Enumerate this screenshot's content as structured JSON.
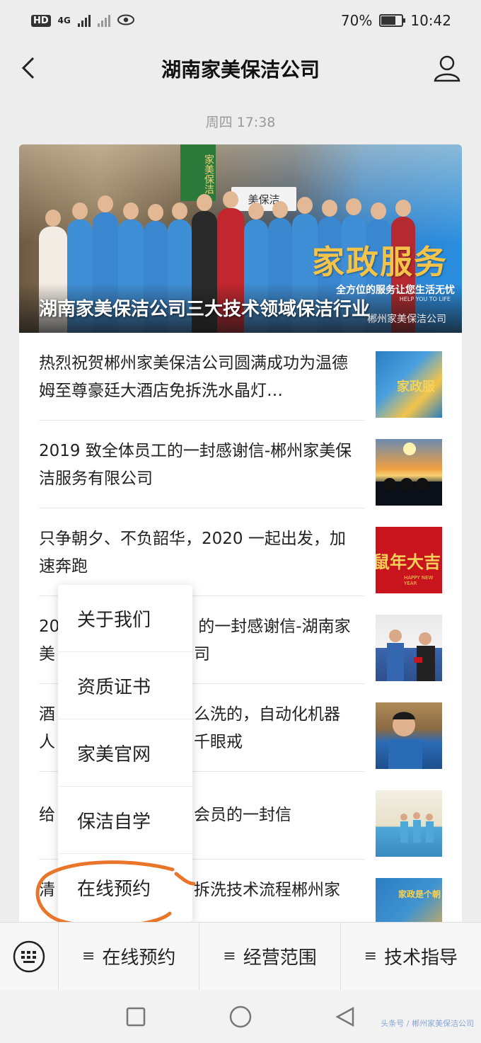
{
  "status_bar": {
    "left_badge": "HD",
    "network": "4G",
    "battery_percent": "70%",
    "battery_level": 0.7,
    "time": "10:42"
  },
  "nav": {
    "title": "湖南家美保洁公司",
    "back_icon": "chevron-left-icon",
    "profile_icon": "person-icon"
  },
  "timestamp": "周四 17:38",
  "hero": {
    "title": "湖南家美保洁公司三大技术领域保洁行业",
    "service_text": "家政服务",
    "slogan": "全方位的服务让您生活无忧",
    "slogan_en": "HELP YOU TO LIFE",
    "watermark": "郴州家美保洁公司",
    "sign_text": "家美保洁",
    "sign_text2": "美保洁"
  },
  "articles": [
    {
      "title": "热烈祝贺郴州家美保洁公司圆满成功为温德姆至尊豪廷大酒店免拆洗水晶灯…"
    },
    {
      "title": "2019 致全体员工的一封感谢信-郴州家美保洁服务有限公司"
    },
    {
      "title": "只争朝夕、不负韶华，2020 一起出发，加速奔跑"
    },
    {
      "title_right": "的一封感谢信-湖南家",
      "title_left": "20",
      "title_left2": "美",
      "title_right2": "司"
    },
    {
      "title_left": "酒",
      "title_right": "么洗的，自动化机器",
      "title_left2": "人",
      "title_right2": "千眼戒"
    },
    {
      "title_left": "给",
      "title_right": "会员的一封信"
    },
    {
      "title_left": "清",
      "title_right": "拆洗技术流程郴州家"
    }
  ],
  "thumb_texts": {
    "a": "家政服",
    "c": "鼠年大吉",
    "c_sub": "HAPPY NEW YEAR",
    "g": "家政是个朝"
  },
  "popup_menu": {
    "items": [
      "关于我们",
      "资质证书",
      "家美官网",
      "保洁自学",
      "在线预约"
    ]
  },
  "bottom_menu": {
    "keyboard_icon": "keyboard-icon",
    "tabs": [
      "在线预约",
      "经营范围",
      "技术指导"
    ]
  },
  "sys_watermark": "头条号 / 郴州家美保洁公司",
  "colors": {
    "annotation": "#e8752a",
    "hero_service": "#f3c34a"
  }
}
